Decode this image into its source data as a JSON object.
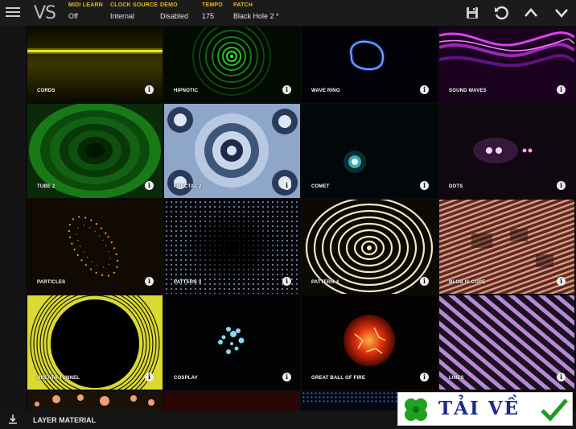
{
  "app": {
    "logo": "VS"
  },
  "header": {
    "fields": [
      {
        "label": "MIDI LEARN",
        "value": "Off"
      },
      {
        "label": "CLOCK SOURCE",
        "value": "Internal"
      },
      {
        "label": "DEMO",
        "value": "Disabled"
      },
      {
        "label": "TEMPO",
        "value": "175"
      },
      {
        "label": "PATCH",
        "value": "Black Hole 2 *"
      }
    ],
    "icons": [
      "save-icon",
      "reset-icon",
      "chevron-up-icon",
      "chevron-down-icon"
    ]
  },
  "tiles": [
    {
      "name": "CORDS"
    },
    {
      "name": "HIPNOTIC"
    },
    {
      "name": "WAVE RING"
    },
    {
      "name": "SOUND WAVES"
    },
    {
      "name": "TUBE 2"
    },
    {
      "name": "FRACTAL 2"
    },
    {
      "name": "COMET"
    },
    {
      "name": "DOTS"
    },
    {
      "name": "PARTICLES"
    },
    {
      "name": "PATTERN 3"
    },
    {
      "name": "PATTERN 4"
    },
    {
      "name": "BLOB IS COPE"
    },
    {
      "name": "BREATH TUNNEL"
    },
    {
      "name": "COSPLAY"
    },
    {
      "name": "GREAT BALL OF FIRE"
    },
    {
      "name": "LINES"
    }
  ],
  "info_glyph": "i",
  "footer": {
    "label": "LAYER MATERIAL",
    "icon": "download-icon"
  },
  "watermark": {
    "text": "TẢI VỀ",
    "icons": [
      "clover-icon",
      "checkmark-icon"
    ]
  }
}
